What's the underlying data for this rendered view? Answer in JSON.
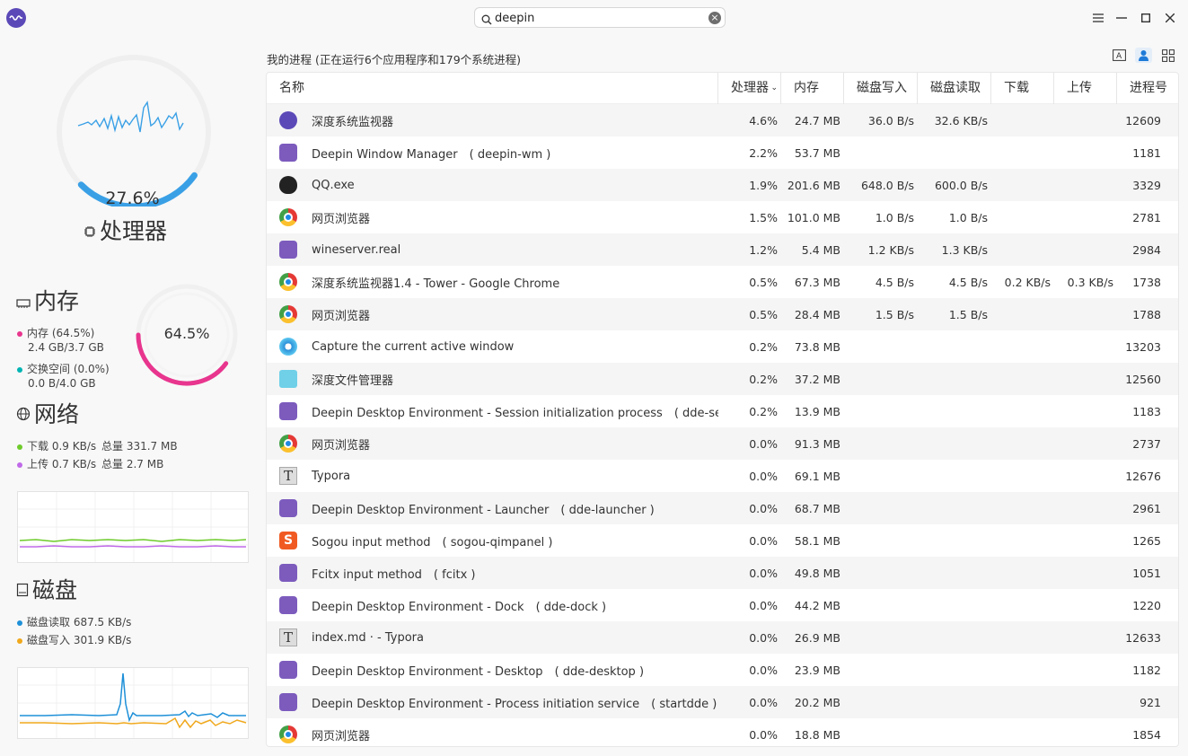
{
  "search": {
    "value": "deepin"
  },
  "cpu": {
    "percent": "27.6%",
    "label": "处理器",
    "fraction": 0.276
  },
  "memory": {
    "title": "内存",
    "percent": "64.5%",
    "fraction": 0.645,
    "mem_label": "内存 (64.5%)",
    "mem_value": "2.4 GB/3.7 GB",
    "swap_label": "交换空间 (0.0%)",
    "swap_value": "0.0 B/4.0 GB"
  },
  "network": {
    "title": "网络",
    "download": "下载 0.9 KB/s",
    "download_total": "总量 331.7 MB",
    "upload": "上传 0.7 KB/s",
    "upload_total": "总量 2.7 MB"
  },
  "disk": {
    "title": "磁盘",
    "read": "磁盘读取 687.5 KB/s",
    "write": "磁盘写入 301.9 KB/s"
  },
  "colors": {
    "cpu": "#3aa0e6",
    "memory": "#e8358e",
    "swap": "#00b4b4",
    "download": "#6ecb2b",
    "upload": "#c06ae8",
    "disk_read": "#1e90d8",
    "disk_write": "#f0a81c"
  },
  "process_header": "我的进程 (正在运行6个应用程序和179个系统进程)",
  "columns": {
    "name": "名称",
    "cpu": "处理器",
    "mem": "内存",
    "disk_write": "磁盘写入",
    "disk_read": "磁盘读取",
    "download": "下载",
    "upload": "上传",
    "pid": "进程号"
  },
  "processes": [
    {
      "icon": "monitor",
      "name": "深度系统监视器",
      "cpu": "4.6%",
      "mem": "24.7 MB",
      "dw": "36.0 B/s",
      "dr": "32.6 KB/s",
      "dl": "",
      "ul": "",
      "pid": "12609"
    },
    {
      "icon": "deepin",
      "name": "Deepin Window Manager　( deepin-wm )",
      "cpu": "2.2%",
      "mem": "53.7 MB",
      "dw": "",
      "dr": "",
      "dl": "",
      "ul": "",
      "pid": "1181"
    },
    {
      "icon": "qq",
      "name": "QQ.exe",
      "cpu": "1.9%",
      "mem": "201.6 MB",
      "dw": "648.0 B/s",
      "dr": "600.0 B/s",
      "dl": "",
      "ul": "",
      "pid": "3329"
    },
    {
      "icon": "chrome",
      "name": "网页浏览器",
      "cpu": "1.5%",
      "mem": "101.0 MB",
      "dw": "1.0 B/s",
      "dr": "1.0 B/s",
      "dl": "",
      "ul": "",
      "pid": "2781"
    },
    {
      "icon": "deepin",
      "name": "wineserver.real",
      "cpu": "1.2%",
      "mem": "5.4 MB",
      "dw": "1.2 KB/s",
      "dr": "1.3 KB/s",
      "dl": "",
      "ul": "",
      "pid": "2984"
    },
    {
      "icon": "chrome",
      "name": "深度系统监视器1.4 - Tower - Google Chrome",
      "cpu": "0.5%",
      "mem": "67.3 MB",
      "dw": "4.5 B/s",
      "dr": "4.5 B/s",
      "dl": "0.2 KB/s",
      "ul": "0.3 KB/s",
      "pid": "1738"
    },
    {
      "icon": "chrome",
      "name": "网页浏览器",
      "cpu": "0.5%",
      "mem": "28.4 MB",
      "dw": "1.5 B/s",
      "dr": "1.5 B/s",
      "dl": "",
      "ul": "",
      "pid": "1788"
    },
    {
      "icon": "capture",
      "name": "Capture the current active window",
      "cpu": "0.2%",
      "mem": "73.8 MB",
      "dw": "",
      "dr": "",
      "dl": "",
      "ul": "",
      "pid": "13203"
    },
    {
      "icon": "file",
      "name": "深度文件管理器",
      "cpu": "0.2%",
      "mem": "37.2 MB",
      "dw": "",
      "dr": "",
      "dl": "",
      "ul": "",
      "pid": "12560"
    },
    {
      "icon": "deepin",
      "name": "Deepin Desktop Environment - Session initialization process　( dde-ses…",
      "cpu": "0.2%",
      "mem": "13.9 MB",
      "dw": "",
      "dr": "",
      "dl": "",
      "ul": "",
      "pid": "1183"
    },
    {
      "icon": "chrome",
      "name": "网页浏览器",
      "cpu": "0.0%",
      "mem": "91.3 MB",
      "dw": "",
      "dr": "",
      "dl": "",
      "ul": "",
      "pid": "2737"
    },
    {
      "icon": "typora",
      "name": "Typora",
      "cpu": "0.0%",
      "mem": "69.1 MB",
      "dw": "",
      "dr": "",
      "dl": "",
      "ul": "",
      "pid": "12676"
    },
    {
      "icon": "deepin",
      "name": "Deepin Desktop Environment - Launcher　( dde-launcher )",
      "cpu": "0.0%",
      "mem": "68.7 MB",
      "dw": "",
      "dr": "",
      "dl": "",
      "ul": "",
      "pid": "2961"
    },
    {
      "icon": "sogou",
      "name": "Sogou input method　( sogou-qimpanel )",
      "cpu": "0.0%",
      "mem": "58.1 MB",
      "dw": "",
      "dr": "",
      "dl": "",
      "ul": "",
      "pid": "1265"
    },
    {
      "icon": "deepin",
      "name": "Fcitx input method　( fcitx )",
      "cpu": "0.0%",
      "mem": "49.8 MB",
      "dw": "",
      "dr": "",
      "dl": "",
      "ul": "",
      "pid": "1051"
    },
    {
      "icon": "deepin",
      "name": "Deepin Desktop Environment - Dock　( dde-dock )",
      "cpu": "0.0%",
      "mem": "44.2 MB",
      "dw": "",
      "dr": "",
      "dl": "",
      "ul": "",
      "pid": "1220"
    },
    {
      "icon": "typora",
      "name": "index.md · - Typora",
      "cpu": "0.0%",
      "mem": "26.9 MB",
      "dw": "",
      "dr": "",
      "dl": "",
      "ul": "",
      "pid": "12633"
    },
    {
      "icon": "deepin",
      "name": "Deepin Desktop Environment - Desktop　( dde-desktop )",
      "cpu": "0.0%",
      "mem": "23.9 MB",
      "dw": "",
      "dr": "",
      "dl": "",
      "ul": "",
      "pid": "1182"
    },
    {
      "icon": "deepin",
      "name": "Deepin Desktop Environment - Process initiation service　( startdde )",
      "cpu": "0.0%",
      "mem": "20.2 MB",
      "dw": "",
      "dr": "",
      "dl": "",
      "ul": "",
      "pid": "921"
    },
    {
      "icon": "chrome",
      "name": "网页浏览器",
      "cpu": "0.0%",
      "mem": "18.8 MB",
      "dw": "",
      "dr": "",
      "dl": "",
      "ul": "",
      "pid": "1854"
    }
  ]
}
